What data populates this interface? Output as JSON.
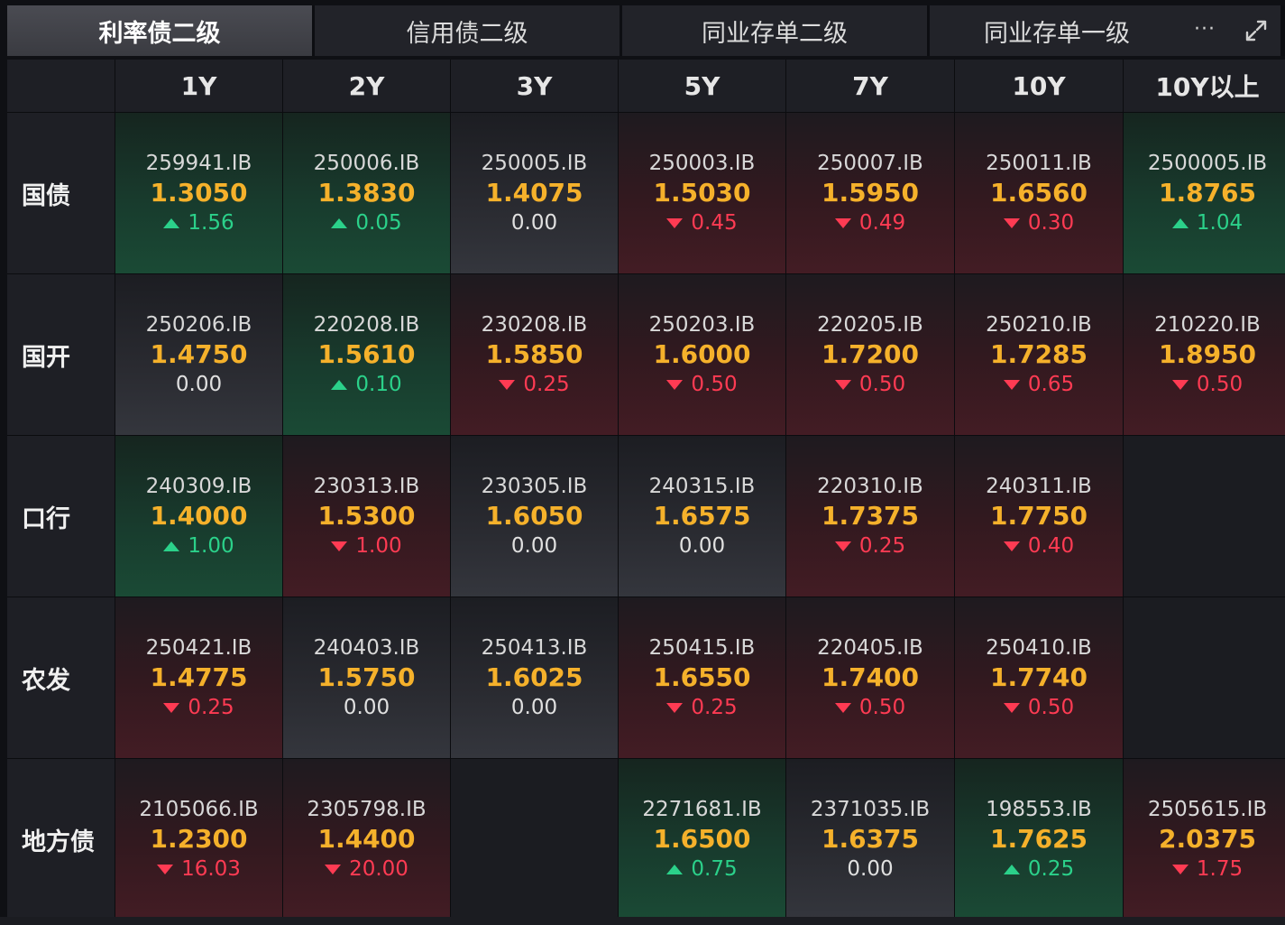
{
  "tabs": [
    {
      "label": "利率债二级",
      "active": true
    },
    {
      "label": "信用债二级",
      "active": false
    },
    {
      "label": "同业存单二级",
      "active": false
    },
    {
      "label": "同业存单一级",
      "active": false
    }
  ],
  "more_label": "···",
  "icons": {
    "more": "more-dots-icon",
    "expand": "expand-icon"
  },
  "colors": {
    "up": "#2bd18a",
    "down": "#ff3b53",
    "yield": "#f5b12b"
  },
  "columns": [
    "1Y",
    "2Y",
    "3Y",
    "5Y",
    "7Y",
    "10Y",
    "10Y以上"
  ],
  "rows": [
    {
      "label": "国债",
      "cells": [
        {
          "code": "259941.IB",
          "yield": "1.3050",
          "change": "1.56",
          "dir": "up"
        },
        {
          "code": "250006.IB",
          "yield": "1.3830",
          "change": "0.05",
          "dir": "up"
        },
        {
          "code": "250005.IB",
          "yield": "1.4075",
          "change": "0.00",
          "dir": "flat"
        },
        {
          "code": "250003.IB",
          "yield": "1.5030",
          "change": "0.45",
          "dir": "down"
        },
        {
          "code": "250007.IB",
          "yield": "1.5950",
          "change": "0.49",
          "dir": "down"
        },
        {
          "code": "250011.IB",
          "yield": "1.6560",
          "change": "0.30",
          "dir": "down"
        },
        {
          "code": "2500005.IB",
          "yield": "1.8765",
          "change": "1.04",
          "dir": "up"
        }
      ]
    },
    {
      "label": "国开",
      "cells": [
        {
          "code": "250206.IB",
          "yield": "1.4750",
          "change": "0.00",
          "dir": "flat"
        },
        {
          "code": "220208.IB",
          "yield": "1.5610",
          "change": "0.10",
          "dir": "up"
        },
        {
          "code": "230208.IB",
          "yield": "1.5850",
          "change": "0.25",
          "dir": "down"
        },
        {
          "code": "250203.IB",
          "yield": "1.6000",
          "change": "0.50",
          "dir": "down"
        },
        {
          "code": "220205.IB",
          "yield": "1.7200",
          "change": "0.50",
          "dir": "down"
        },
        {
          "code": "250210.IB",
          "yield": "1.7285",
          "change": "0.65",
          "dir": "down"
        },
        {
          "code": "210220.IB",
          "yield": "1.8950",
          "change": "0.50",
          "dir": "down"
        }
      ]
    },
    {
      "label": "口行",
      "cells": [
        {
          "code": "240309.IB",
          "yield": "1.4000",
          "change": "1.00",
          "dir": "up"
        },
        {
          "code": "230313.IB",
          "yield": "1.5300",
          "change": "1.00",
          "dir": "down"
        },
        {
          "code": "230305.IB",
          "yield": "1.6050",
          "change": "0.00",
          "dir": "flat"
        },
        {
          "code": "240315.IB",
          "yield": "1.6575",
          "change": "0.00",
          "dir": "flat"
        },
        {
          "code": "220310.IB",
          "yield": "1.7375",
          "change": "0.25",
          "dir": "down"
        },
        {
          "code": "240311.IB",
          "yield": "1.7750",
          "change": "0.40",
          "dir": "down"
        },
        null
      ]
    },
    {
      "label": "农发",
      "cells": [
        {
          "code": "250421.IB",
          "yield": "1.4775",
          "change": "0.25",
          "dir": "down"
        },
        {
          "code": "240403.IB",
          "yield": "1.5750",
          "change": "0.00",
          "dir": "flat"
        },
        {
          "code": "250413.IB",
          "yield": "1.6025",
          "change": "0.00",
          "dir": "flat"
        },
        {
          "code": "250415.IB",
          "yield": "1.6550",
          "change": "0.25",
          "dir": "down"
        },
        {
          "code": "220405.IB",
          "yield": "1.7400",
          "change": "0.50",
          "dir": "down"
        },
        {
          "code": "250410.IB",
          "yield": "1.7740",
          "change": "0.50",
          "dir": "down"
        },
        null
      ]
    },
    {
      "label": "地方债",
      "cells": [
        {
          "code": "2105066.IB",
          "yield": "1.2300",
          "change": "16.03",
          "dir": "down"
        },
        {
          "code": "2305798.IB",
          "yield": "1.4400",
          "change": "20.00",
          "dir": "down"
        },
        null,
        {
          "code": "2271681.IB",
          "yield": "1.6500",
          "change": "0.75",
          "dir": "up"
        },
        {
          "code": "2371035.IB",
          "yield": "1.6375",
          "change": "0.00",
          "dir": "flat"
        },
        {
          "code": "198553.IB",
          "yield": "1.7625",
          "change": "0.25",
          "dir": "up"
        },
        {
          "code": "2505615.IB",
          "yield": "2.0375",
          "change": "1.75",
          "dir": "down"
        }
      ]
    }
  ]
}
